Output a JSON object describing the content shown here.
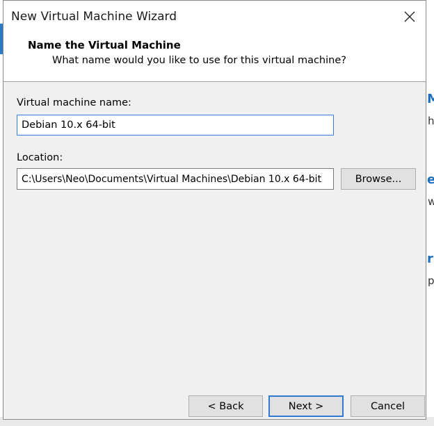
{
  "window": {
    "title": "New Virtual Machine Wizard",
    "close_symbol": "✕"
  },
  "header": {
    "title": "Name the Virtual Machine",
    "subtitle": "What name would you like to use for this virtual machine?"
  },
  "form": {
    "vm_name_label": "Virtual machine name:",
    "vm_name_value": "Debian 10.x 64-bit",
    "location_label": "Location:",
    "location_value": "C:\\Users\\Neo\\Documents\\Virtual Machines\\Debian 10.x 64-bit",
    "browse_label": "Browse..."
  },
  "footer": {
    "back_label": "< Back",
    "next_label": "Next >",
    "cancel_label": "Cancel"
  },
  "background": {
    "fragments": [
      "M",
      "h",
      "e",
      "w",
      "r",
      "p"
    ]
  },
  "colors": {
    "accent": "#2f79d3",
    "focus": "#3a7bd5",
    "dialog_bg": "#f0f0f0"
  }
}
